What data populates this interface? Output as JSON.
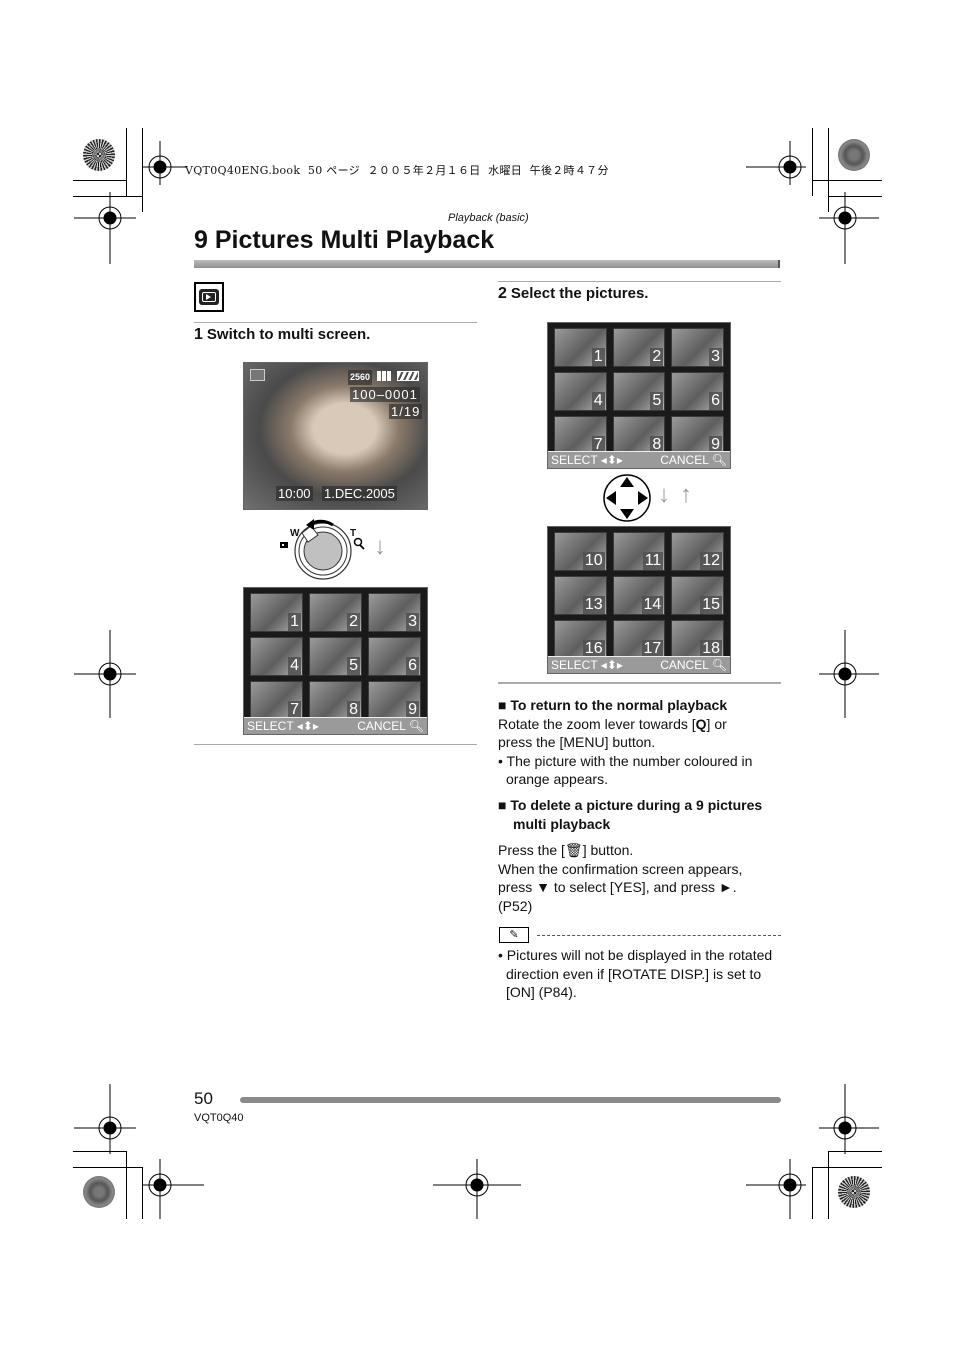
{
  "print_header": "VQT0Q40ENG.book  50 ページ  ２００５年２月１６日  水曜日  午後２時４７分",
  "section_label": "Playback (basic)",
  "title": "9 Pictures Multi Playback",
  "mode_icon": "playback-mode-icon",
  "step1": {
    "number": "1",
    "text": "Switch to multi screen."
  },
  "step2": {
    "number": "2",
    "text": "Select the pictures."
  },
  "single_screen": {
    "resolution": "2560",
    "file_number": "100–0001",
    "frame": "1/19",
    "time": "10:00",
    "date": "1.DEC.2005"
  },
  "zoom_lever": {
    "w_label": "W",
    "t_label": "T"
  },
  "screens": {
    "select_label": "SELECT",
    "cancel_label": "CANCEL",
    "page1": [
      "1",
      "2",
      "3",
      "4",
      "5",
      "6",
      "7",
      "8",
      "9"
    ],
    "page2": [
      "10",
      "11",
      "12",
      "13",
      "14",
      "15",
      "16",
      "17",
      "18"
    ]
  },
  "notes": {
    "return_heading": "To return to the normal playback",
    "return_line1a": "Rotate the zoom lever towards [",
    "return_line1b": "] or",
    "return_line2": "press the [MENU] button.",
    "return_bullet": "• The picture with the number coloured in orange appears.",
    "delete_heading": "To delete a picture during a 9 pictures multi playback",
    "delete_line1a": "Press the [",
    "delete_line1b": "] button.",
    "delete_line2": "When the confirmation screen appears,",
    "delete_line3": "press ▼ to select [YES], and press ►.",
    "delete_line4": "(P52)",
    "tip_bullet": "• Pictures will not be displayed in the rotated direction even if [ROTATE DISP.] is set to [ON] (P84)."
  },
  "footer": {
    "page_number": "50",
    "code": "VQT0Q40"
  }
}
